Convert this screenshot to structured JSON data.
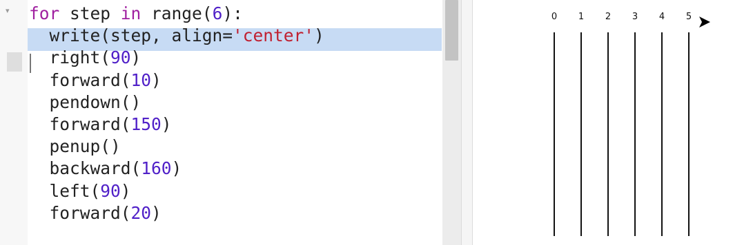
{
  "editor": {
    "fold_icon": "fold-toggle-icon",
    "lines": [
      [
        {
          "t": "for",
          "c": "kw"
        },
        {
          "t": " step ",
          "c": ""
        },
        {
          "t": "in",
          "c": "kw"
        },
        {
          "t": " range(",
          "c": ""
        },
        {
          "t": "6",
          "c": "num"
        },
        {
          "t": "):",
          "c": ""
        }
      ],
      [
        {
          "t": "  write(step, align=",
          "c": ""
        },
        {
          "t": "'center'",
          "c": "str"
        },
        {
          "t": ")",
          "c": ""
        }
      ],
      [
        {
          "t": "  right(",
          "c": ""
        },
        {
          "t": "90",
          "c": "num"
        },
        {
          "t": ")",
          "c": ""
        }
      ],
      [
        {
          "t": "  forward(",
          "c": ""
        },
        {
          "t": "10",
          "c": "num"
        },
        {
          "t": ")",
          "c": ""
        }
      ],
      [
        {
          "t": "  pendown()",
          "c": ""
        }
      ],
      [
        {
          "t": "  forward(",
          "c": ""
        },
        {
          "t": "150",
          "c": "num"
        },
        {
          "t": ")",
          "c": ""
        }
      ],
      [
        {
          "t": "  penup()",
          "c": ""
        }
      ],
      [
        {
          "t": "  backward(",
          "c": ""
        },
        {
          "t": "160",
          "c": "num"
        },
        {
          "t": ")",
          "c": ""
        }
      ],
      [
        {
          "t": "  left(",
          "c": ""
        },
        {
          "t": "90",
          "c": "num"
        },
        {
          "t": ")",
          "c": ""
        }
      ],
      [
        {
          "t": "  forward(",
          "c": ""
        },
        {
          "t": "20",
          "c": "num"
        },
        {
          "t": ")",
          "c": ""
        }
      ]
    ]
  },
  "canvas": {
    "labels": [
      "0",
      "1",
      "2",
      "3",
      "4",
      "5"
    ],
    "turtle_icon": "turtle-arrow-icon"
  },
  "colors": {
    "keyword": "#a020a0",
    "number": "#5020c8",
    "string": "#c02030",
    "active_line": "#c7dbf4"
  }
}
